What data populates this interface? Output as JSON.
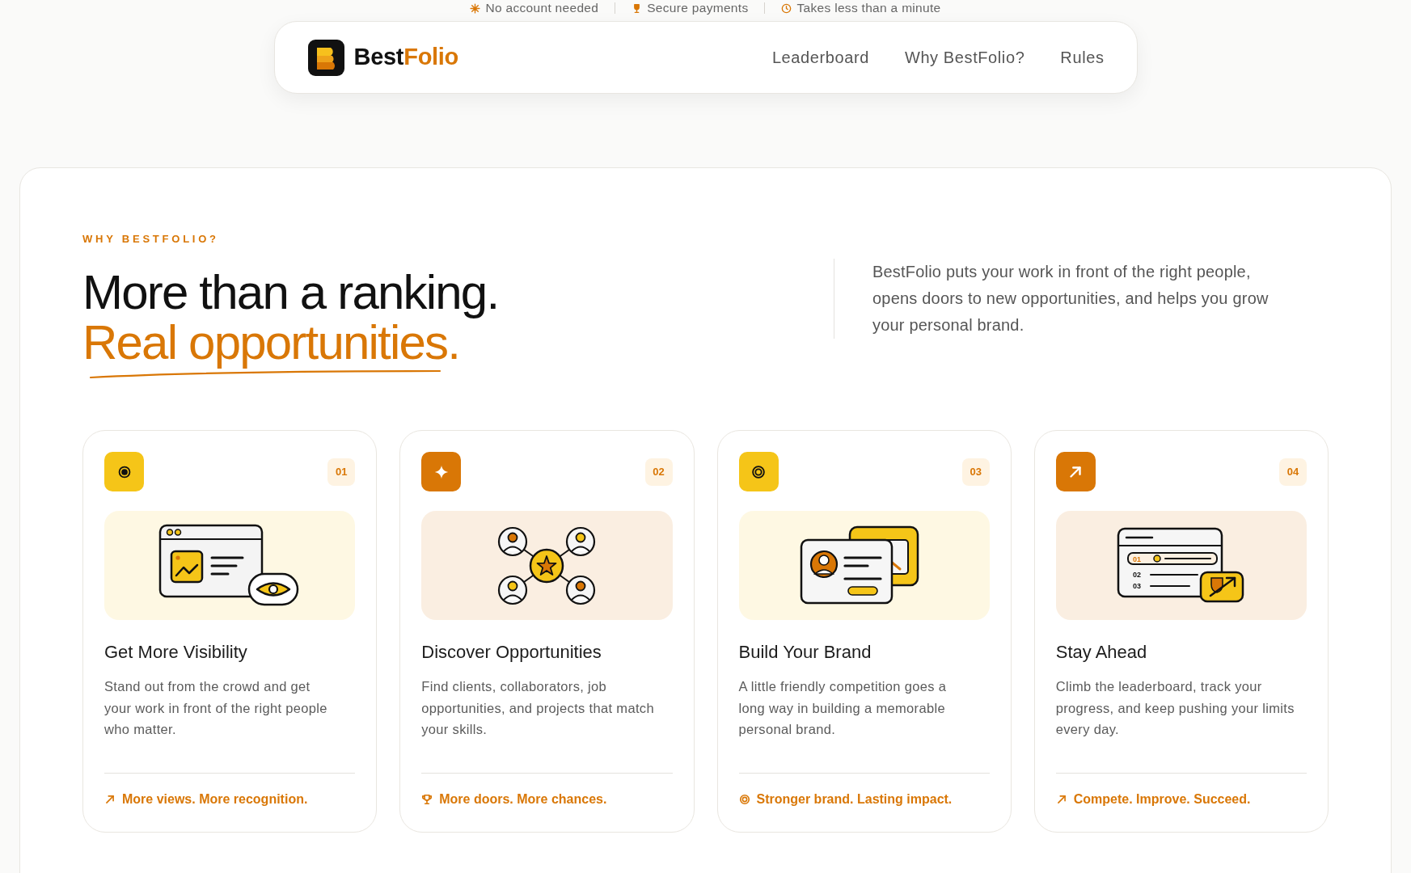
{
  "top_strip": [
    {
      "text": "No account needed"
    },
    {
      "text": "Secure payments"
    },
    {
      "text": "Takes less than a minute"
    }
  ],
  "navbar": {
    "brand": {
      "prefix": "Best",
      "suffix": "Folio"
    },
    "links": [
      {
        "label": "Leaderboard"
      },
      {
        "label": "Why BestFolio?"
      },
      {
        "label": "Rules"
      }
    ]
  },
  "section": {
    "eyebrow": "WHY BESTFOLIO?",
    "heading": {
      "line_1": "More than a ranking.",
      "line_2": "Real opportunities."
    },
    "intro_lines": [
      "BestFolio puts your work in front of the right people,",
      "opens doors to new opportunities, and helps you grow",
      "your personal brand."
    ],
    "cards": [
      {
        "number": "01",
        "color": "#f5c518",
        "title": "Get More Visibility",
        "description_lines": [
          "Stand out from the crowd and get",
          "your work in front of the right people",
          "who matter."
        ],
        "tagline": "More views. More recognition."
      },
      {
        "number": "02",
        "color": "#d97706",
        "title": "Discover Opportunities",
        "description_lines": [
          "Find clients, collaborators, job",
          "opportunities, and projects that match",
          "your skills."
        ],
        "tagline": "More doors. More chances."
      },
      {
        "number": "03",
        "color": "#f5c518",
        "title": "Build Your Brand",
        "description_lines": [
          "A little friendly competition goes a",
          "long way in building a memorable",
          "personal brand."
        ],
        "tagline": "Stronger brand. Lasting impact."
      },
      {
        "number": "04",
        "color": "#d97706",
        "title": "Stay Ahead",
        "description_lines": [
          "Climb the leaderboard, track your",
          "progress, and keep pushing your limits",
          "every day."
        ],
        "tagline": "Compete. Improve. Succeed.",
        "illustration_labels": [
          "01",
          "02",
          "03"
        ]
      }
    ]
  }
}
